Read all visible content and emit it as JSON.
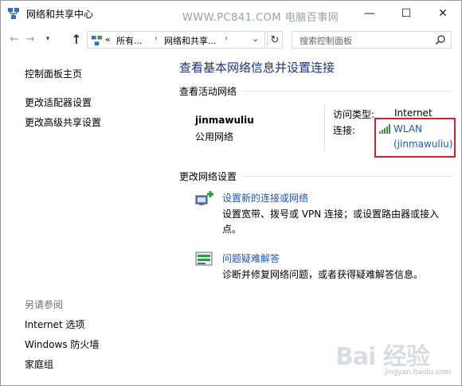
{
  "window": {
    "title": "网络和共享中心",
    "watermark": "WWW.PC841.COM 电脑百事网",
    "minimize": "—",
    "maximize": "☐",
    "close": "✕"
  },
  "nav": {
    "back": "←",
    "forward": "→",
    "recent": "▾",
    "up": "↑",
    "address_parts": [
      "«",
      "所有...",
      "›",
      "网络和共享...",
      "›"
    ],
    "address_dropdown": "⌄",
    "refresh": "↻",
    "search_placeholder": "搜索控制面板"
  },
  "sidebar": {
    "home": "控制面板主页",
    "adapter_settings": "更改适配器设置",
    "advanced_sharing": "更改高级共享设置",
    "see_also": "另请参阅",
    "see_also_items": [
      "Internet 选项",
      "Windows 防火墙",
      "家庭组"
    ]
  },
  "main": {
    "title": "查看基本网络信息并设置连接",
    "active_networks_label": "查看活动网络",
    "network": {
      "name": "jinmawuliu",
      "type": "公用网络",
      "access_type_label": "访问类型:",
      "access_type_value": "Internet",
      "connection_label": "连接:",
      "connection_line1": "WLAN",
      "connection_line2": "(jinmawuliu)"
    },
    "change_settings_label": "更改网络设置",
    "tasks": [
      {
        "link": "设置新的连接或网络",
        "desc": "设置宽带、拨号或 VPN 连接；或设置路由器或接入点。"
      },
      {
        "link": "问题疑难解答",
        "desc": "诊断并修复网络问题，或者获得疑难解答信息。"
      }
    ]
  },
  "watermark_baidu": {
    "text": "Bai 经验",
    "sub": "jingyan.baidu.com"
  },
  "colors": {
    "title_blue": "#1e3287",
    "link_blue": "#1a56c9",
    "highlight_red": "#c9242f"
  }
}
